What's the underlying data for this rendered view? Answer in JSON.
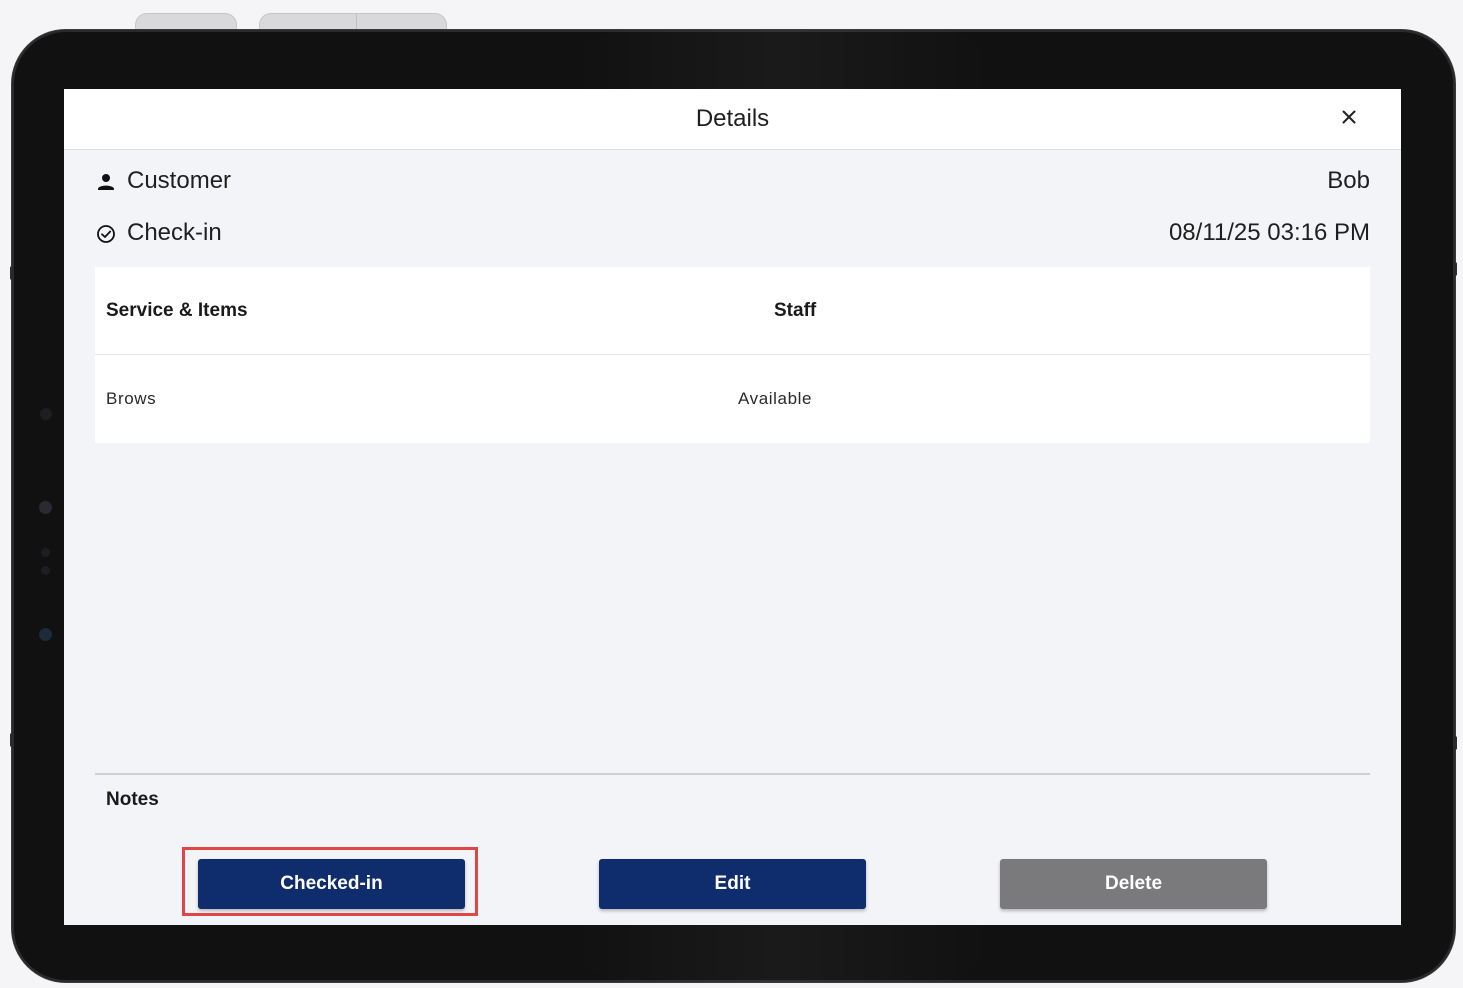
{
  "dialog": {
    "title": "Details"
  },
  "customer": {
    "label": "Customer",
    "value": "Bob",
    "icon": "person-icon"
  },
  "checkin": {
    "label": "Check-in",
    "value": "08/11/25 03:16 PM",
    "icon": "check-circle-icon"
  },
  "table": {
    "headers": [
      "Service & Items",
      "Staff"
    ],
    "rows": [
      {
        "service": "Brows",
        "staff": "Available"
      }
    ]
  },
  "notes": {
    "label": "Notes"
  },
  "actions": {
    "checked_in_label": "Checked-in",
    "edit_label": "Edit",
    "delete_label": "Delete"
  },
  "colors": {
    "primary": "#0f2d6c",
    "disabled": "#7a7a7c",
    "highlight": "#e04646",
    "background": "#f3f4f8"
  }
}
